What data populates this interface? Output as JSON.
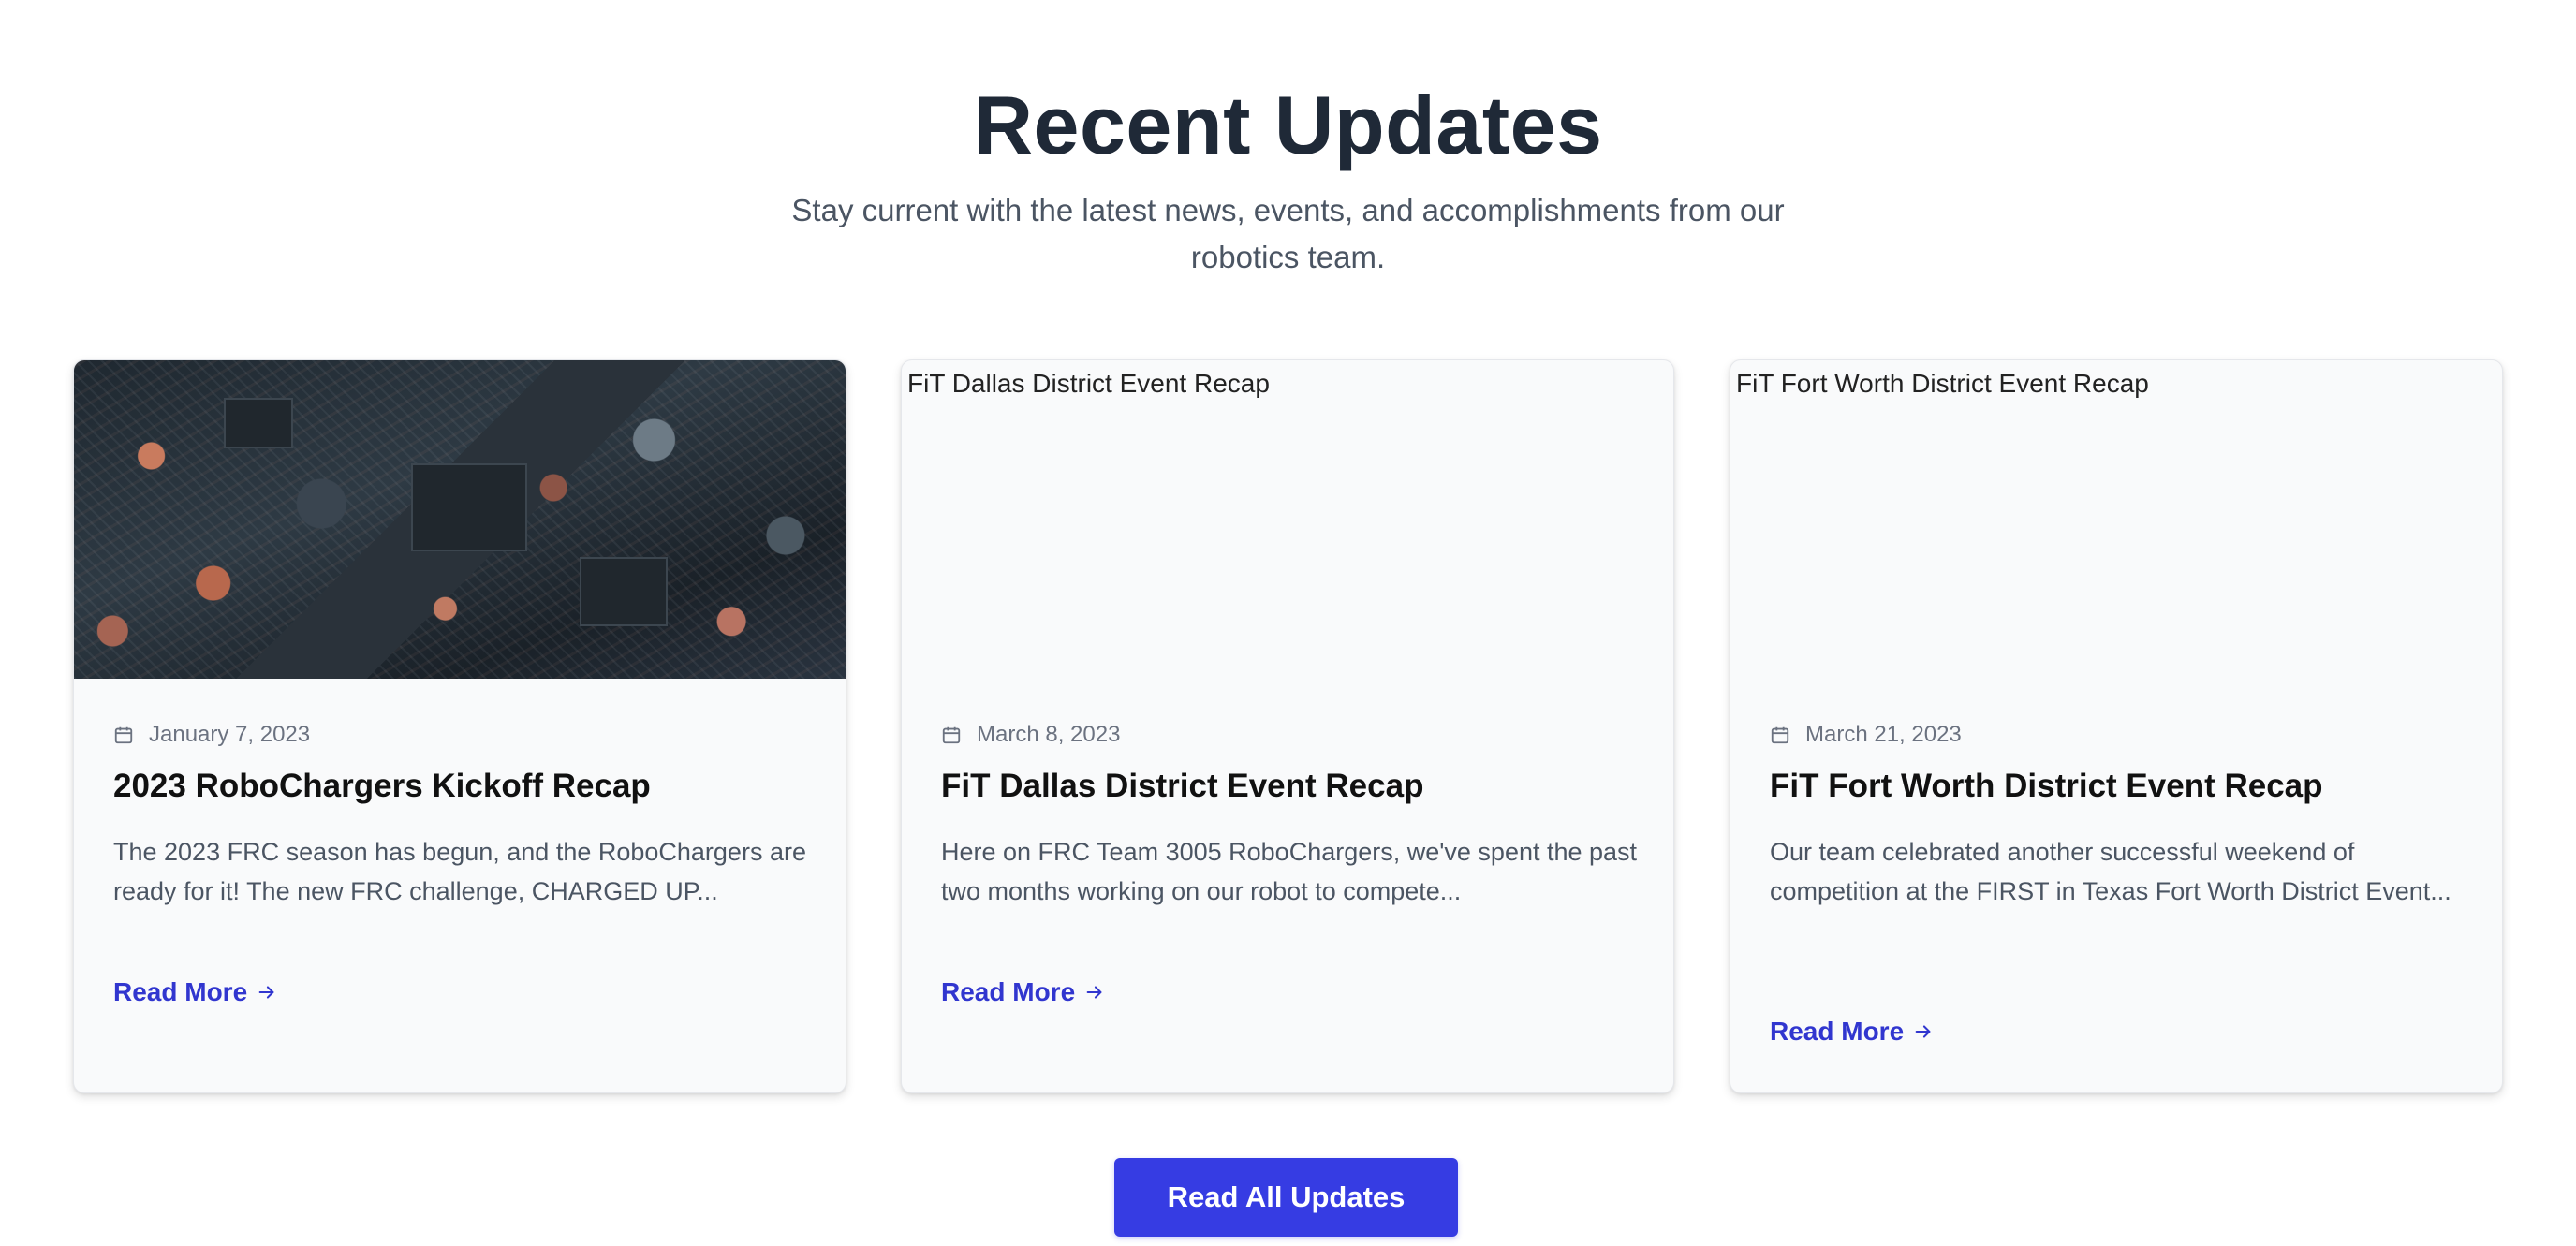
{
  "section": {
    "title": "Recent Updates",
    "subtitle": "Stay current with the latest news, events, and accomplishments from our robotics team."
  },
  "icons": {
    "date": "calendar-icon",
    "read_more": "arrow-right-icon"
  },
  "colors": {
    "accent": "#363ce3",
    "link": "#3136cf",
    "heading": "#1f2937",
    "muted": "#6b7280",
    "card_bg": "#f9fafb"
  },
  "posts": [
    {
      "image_alt": "",
      "date": "January 7, 2023",
      "title": "2023 RoboChargers Kickoff Recap",
      "excerpt": "The 2023 FRC season has begun, and the RoboChargers are ready for it! The new FRC challenge, CHARGED UP...",
      "link_label": "Read More"
    },
    {
      "image_alt": "FiT Dallas District Event Recap",
      "date": "March 8, 2023",
      "title": "FiT Dallas District Event Recap",
      "excerpt": "Here on FRC Team 3005 RoboChargers, we've spent the past two months working on our robot to compete...",
      "link_label": "Read More"
    },
    {
      "image_alt": "FiT Fort Worth District Event Recap",
      "date": "March 21, 2023",
      "title": "FiT Fort Worth District Event Recap",
      "excerpt": "Our team celebrated another successful weekend of competition at the FIRST in Texas Fort Worth District Event...",
      "link_label": "Read More"
    }
  ],
  "cta": {
    "label": "Read All Updates"
  }
}
